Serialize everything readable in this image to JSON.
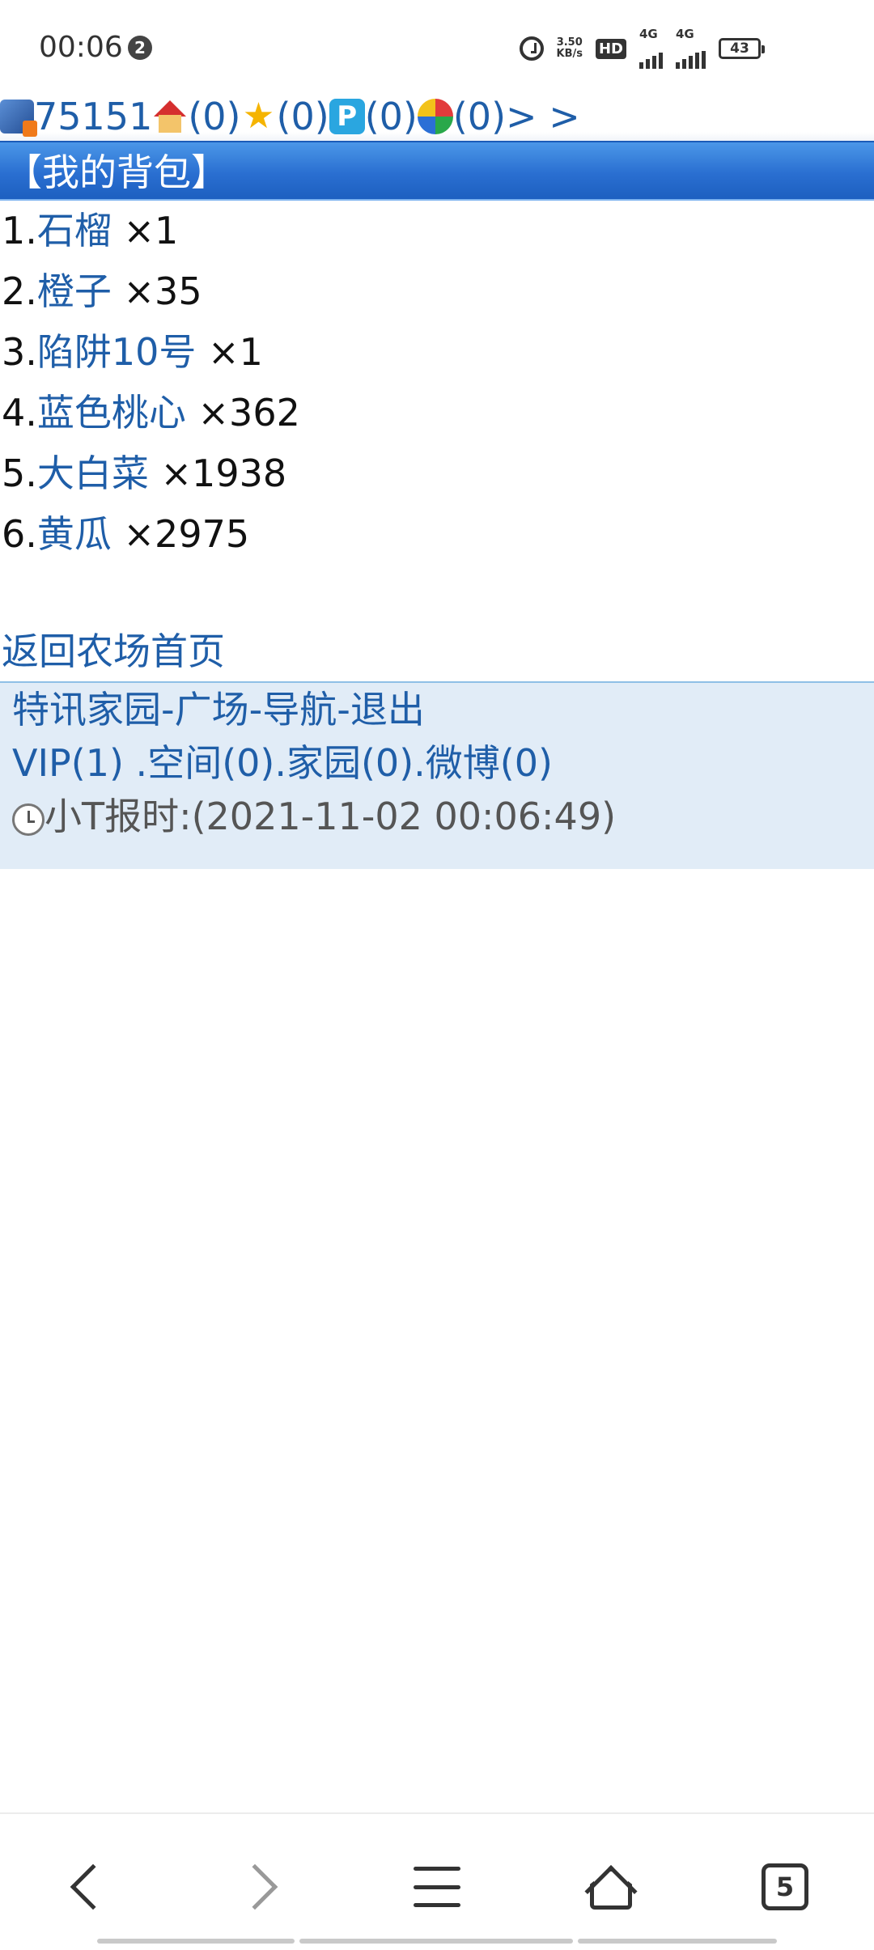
{
  "status_bar": {
    "time": "00:06",
    "notification_count": "2",
    "net_speed": "3.50",
    "net_speed_unit": "KB/s",
    "hd_label": "HD",
    "sim1_label": "4G",
    "sim2_label": "4G",
    "battery": "43"
  },
  "top_line": {
    "user_id": "75151",
    "home_count": "(0)",
    "star_count": "(0)",
    "p_count": "(0)",
    "ball_count": "(0)",
    "more": "> >"
  },
  "title": "【我的背包】",
  "items": [
    {
      "index": "1.",
      "name": "石榴",
      "qty": " ×1"
    },
    {
      "index": "2.",
      "name": "橙子",
      "qty": " ×35"
    },
    {
      "index": "3.",
      "name": "陷阱10号",
      "qty": " ×1"
    },
    {
      "index": "4.",
      "name": "蓝色桃心",
      "qty": " ×362"
    },
    {
      "index": "5.",
      "name": "大白菜",
      "qty": " ×1938"
    },
    {
      "index": "6.",
      "name": "黄瓜",
      "qty": " ×2975"
    }
  ],
  "back_link": "返回农场首页",
  "footer": {
    "nav": [
      "特讯家园",
      "广场",
      "导航",
      "退出"
    ],
    "sep": "-",
    "stats": [
      {
        "label": "VIP(1)",
        "sep": " ."
      },
      {
        "label": "空间(0)",
        "sep": "."
      },
      {
        "label": "家园(0)",
        "sep": "."
      },
      {
        "label": "微博(0)",
        "sep": ""
      }
    ],
    "time_report": "小T报时:(2021-11-02 00:06:49)"
  },
  "bottom_bar": {
    "tabs_count": "5"
  }
}
